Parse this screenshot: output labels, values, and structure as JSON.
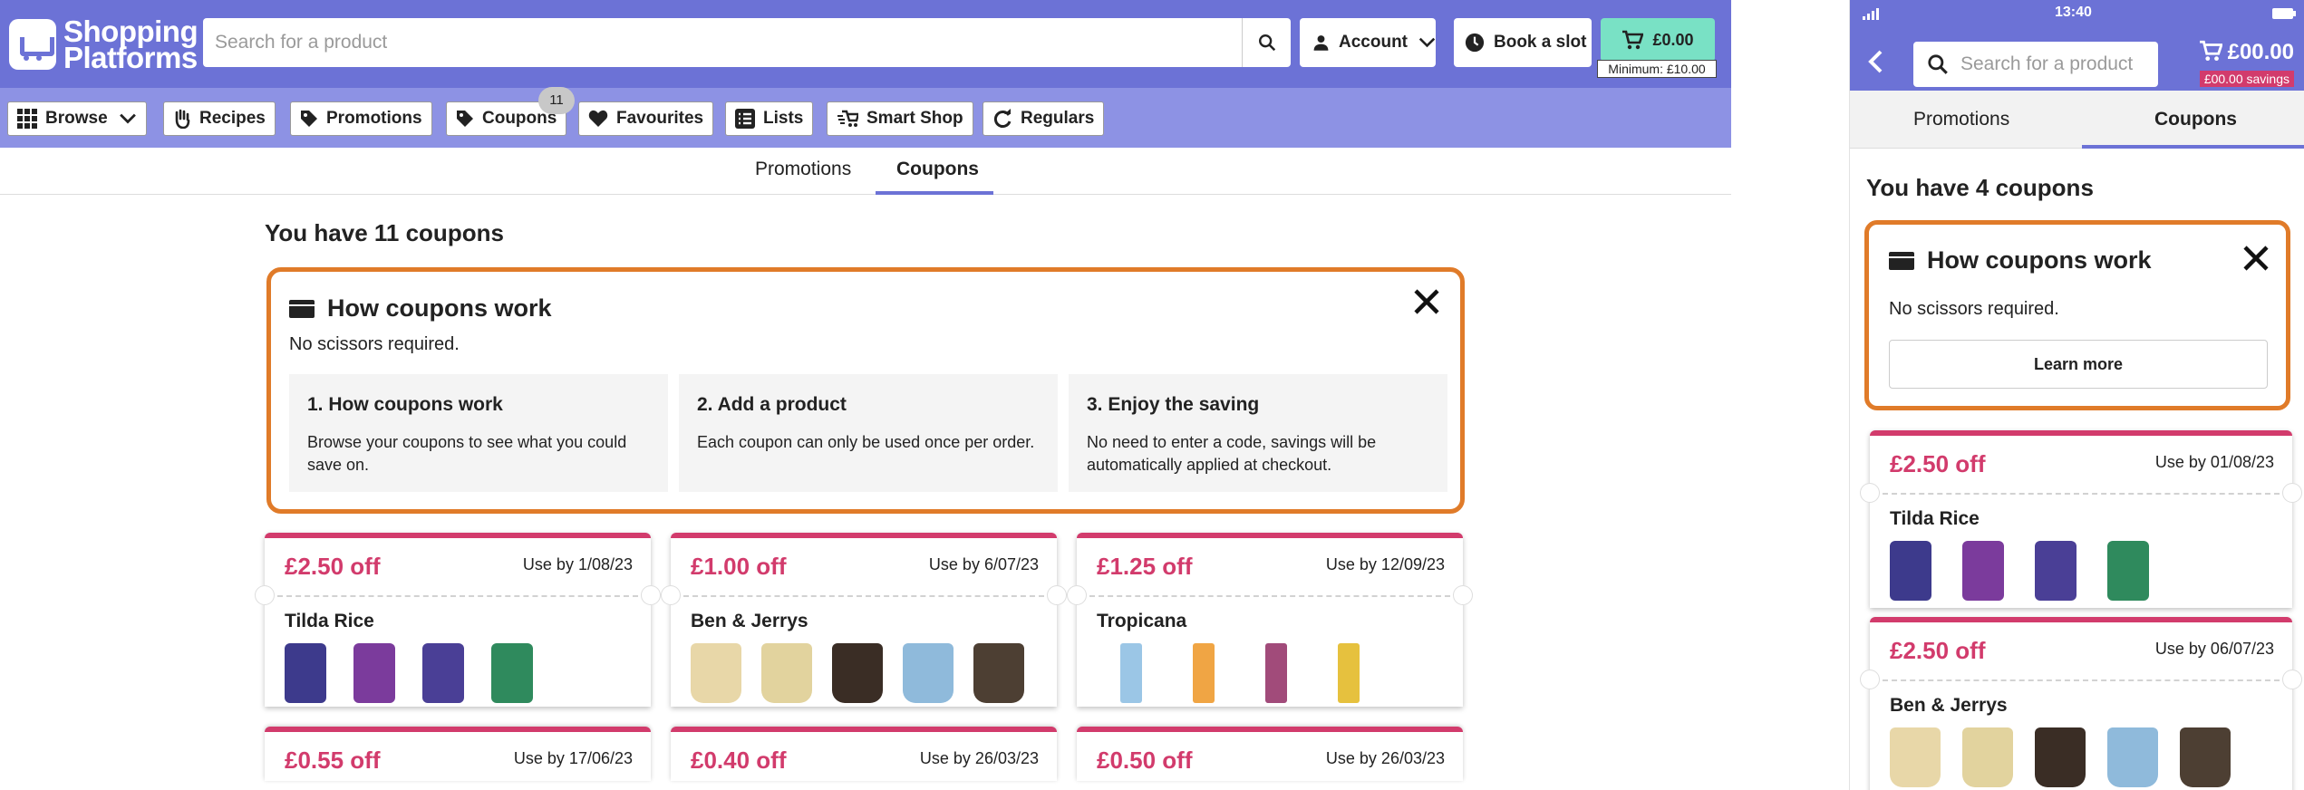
{
  "desktop": {
    "logo": {
      "line1": "Shopping",
      "line2": "Platforms"
    },
    "search": {
      "placeholder": "Search for a product"
    },
    "header": {
      "account_label": "Account",
      "book_slot_label": "Book a slot",
      "cart_total": "£0.00",
      "minimum_text": "Minimum: £10.00"
    },
    "nav": [
      {
        "label": "Browse",
        "icon": "grid-icon"
      },
      {
        "label": "Recipes",
        "icon": "hand-icon"
      },
      {
        "label": "Promotions",
        "icon": "tag-icon"
      },
      {
        "label": "Coupons",
        "icon": "tag-icon",
        "badge": "11"
      },
      {
        "label": "Favourites",
        "icon": "heart-icon"
      },
      {
        "label": "Lists",
        "icon": "list-icon"
      },
      {
        "label": "Smart Shop",
        "icon": "smart-shop-icon"
      },
      {
        "label": "Regulars",
        "icon": "refresh-icon"
      }
    ],
    "tabs": [
      {
        "label": "Promotions"
      },
      {
        "label": "Coupons",
        "active": true
      }
    ],
    "heading": "You have 11 coupons",
    "how": {
      "title": "How coupons work",
      "subtitle": "No scissors required.",
      "steps": [
        {
          "title": "1.  How coupons work",
          "desc": "Browse your coupons to see what you could save on."
        },
        {
          "title": "2. Add a product",
          "desc": "Each coupon can only be used once per order."
        },
        {
          "title": "3.  Enjoy the saving",
          "desc": "No need to enter a code, savings will be automatically applied at checkout."
        }
      ]
    },
    "coupons": [
      {
        "amount": "£2.50 off",
        "use_by": "Use by 1/08/23",
        "name": "Tilda Rice"
      },
      {
        "amount": "£1.00 off",
        "use_by": "Use by 6/07/23",
        "name": "Ben & Jerrys"
      },
      {
        "amount": "£1.25 off",
        "use_by": "Use by 12/09/23",
        "name": "Tropicana"
      },
      {
        "amount": "£0.55 off",
        "use_by": "Use by 17/06/23"
      },
      {
        "amount": "£0.40 off",
        "use_by": "Use by 26/03/23"
      },
      {
        "amount": "£0.50 off",
        "use_by": "Use by 26/03/23"
      }
    ]
  },
  "mobile": {
    "status": {
      "time": "13:40"
    },
    "search": {
      "placeholder": "Search for a product"
    },
    "cart_total": "£00.00",
    "savings": "£00.00 savings",
    "tabs": [
      {
        "label": "Promotions"
      },
      {
        "label": "Coupons",
        "active": true
      }
    ],
    "heading": "You have 4 coupons",
    "how": {
      "title": "How coupons work",
      "subtitle": "No scissors required.",
      "learn_more": "Learn more"
    },
    "coupons": [
      {
        "amount": "£2.50 off",
        "use_by": "Use by 01/08/23",
        "name": "Tilda Rice"
      },
      {
        "amount": "£2.50 off",
        "use_by": "Use by 06/07/23",
        "name": "Ben & Jerrys"
      }
    ]
  },
  "colors": {
    "brand": "#6c72d6",
    "accent": "#d23b6c",
    "highlight": "#e07b29",
    "cart": "#79e1c5"
  }
}
